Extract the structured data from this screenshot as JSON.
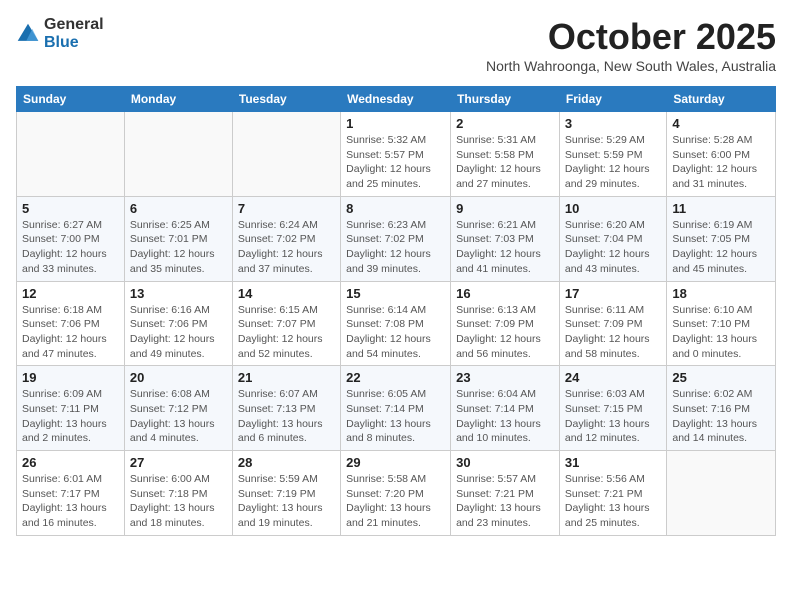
{
  "header": {
    "logo_general": "General",
    "logo_blue": "Blue",
    "month": "October 2025",
    "location": "North Wahroonga, New South Wales, Australia"
  },
  "weekdays": [
    "Sunday",
    "Monday",
    "Tuesday",
    "Wednesday",
    "Thursday",
    "Friday",
    "Saturday"
  ],
  "weeks": [
    [
      {
        "day": "",
        "info": ""
      },
      {
        "day": "",
        "info": ""
      },
      {
        "day": "",
        "info": ""
      },
      {
        "day": "1",
        "info": "Sunrise: 5:32 AM\nSunset: 5:57 PM\nDaylight: 12 hours\nand 25 minutes."
      },
      {
        "day": "2",
        "info": "Sunrise: 5:31 AM\nSunset: 5:58 PM\nDaylight: 12 hours\nand 27 minutes."
      },
      {
        "day": "3",
        "info": "Sunrise: 5:29 AM\nSunset: 5:59 PM\nDaylight: 12 hours\nand 29 minutes."
      },
      {
        "day": "4",
        "info": "Sunrise: 5:28 AM\nSunset: 6:00 PM\nDaylight: 12 hours\nand 31 minutes."
      }
    ],
    [
      {
        "day": "5",
        "info": "Sunrise: 6:27 AM\nSunset: 7:00 PM\nDaylight: 12 hours\nand 33 minutes."
      },
      {
        "day": "6",
        "info": "Sunrise: 6:25 AM\nSunset: 7:01 PM\nDaylight: 12 hours\nand 35 minutes."
      },
      {
        "day": "7",
        "info": "Sunrise: 6:24 AM\nSunset: 7:02 PM\nDaylight: 12 hours\nand 37 minutes."
      },
      {
        "day": "8",
        "info": "Sunrise: 6:23 AM\nSunset: 7:02 PM\nDaylight: 12 hours\nand 39 minutes."
      },
      {
        "day": "9",
        "info": "Sunrise: 6:21 AM\nSunset: 7:03 PM\nDaylight: 12 hours\nand 41 minutes."
      },
      {
        "day": "10",
        "info": "Sunrise: 6:20 AM\nSunset: 7:04 PM\nDaylight: 12 hours\nand 43 minutes."
      },
      {
        "day": "11",
        "info": "Sunrise: 6:19 AM\nSunset: 7:05 PM\nDaylight: 12 hours\nand 45 minutes."
      }
    ],
    [
      {
        "day": "12",
        "info": "Sunrise: 6:18 AM\nSunset: 7:06 PM\nDaylight: 12 hours\nand 47 minutes."
      },
      {
        "day": "13",
        "info": "Sunrise: 6:16 AM\nSunset: 7:06 PM\nDaylight: 12 hours\nand 49 minutes."
      },
      {
        "day": "14",
        "info": "Sunrise: 6:15 AM\nSunset: 7:07 PM\nDaylight: 12 hours\nand 52 minutes."
      },
      {
        "day": "15",
        "info": "Sunrise: 6:14 AM\nSunset: 7:08 PM\nDaylight: 12 hours\nand 54 minutes."
      },
      {
        "day": "16",
        "info": "Sunrise: 6:13 AM\nSunset: 7:09 PM\nDaylight: 12 hours\nand 56 minutes."
      },
      {
        "day": "17",
        "info": "Sunrise: 6:11 AM\nSunset: 7:09 PM\nDaylight: 12 hours\nand 58 minutes."
      },
      {
        "day": "18",
        "info": "Sunrise: 6:10 AM\nSunset: 7:10 PM\nDaylight: 13 hours\nand 0 minutes."
      }
    ],
    [
      {
        "day": "19",
        "info": "Sunrise: 6:09 AM\nSunset: 7:11 PM\nDaylight: 13 hours\nand 2 minutes."
      },
      {
        "day": "20",
        "info": "Sunrise: 6:08 AM\nSunset: 7:12 PM\nDaylight: 13 hours\nand 4 minutes."
      },
      {
        "day": "21",
        "info": "Sunrise: 6:07 AM\nSunset: 7:13 PM\nDaylight: 13 hours\nand 6 minutes."
      },
      {
        "day": "22",
        "info": "Sunrise: 6:05 AM\nSunset: 7:14 PM\nDaylight: 13 hours\nand 8 minutes."
      },
      {
        "day": "23",
        "info": "Sunrise: 6:04 AM\nSunset: 7:14 PM\nDaylight: 13 hours\nand 10 minutes."
      },
      {
        "day": "24",
        "info": "Sunrise: 6:03 AM\nSunset: 7:15 PM\nDaylight: 13 hours\nand 12 minutes."
      },
      {
        "day": "25",
        "info": "Sunrise: 6:02 AM\nSunset: 7:16 PM\nDaylight: 13 hours\nand 14 minutes."
      }
    ],
    [
      {
        "day": "26",
        "info": "Sunrise: 6:01 AM\nSunset: 7:17 PM\nDaylight: 13 hours\nand 16 minutes."
      },
      {
        "day": "27",
        "info": "Sunrise: 6:00 AM\nSunset: 7:18 PM\nDaylight: 13 hours\nand 18 minutes."
      },
      {
        "day": "28",
        "info": "Sunrise: 5:59 AM\nSunset: 7:19 PM\nDaylight: 13 hours\nand 19 minutes."
      },
      {
        "day": "29",
        "info": "Sunrise: 5:58 AM\nSunset: 7:20 PM\nDaylight: 13 hours\nand 21 minutes."
      },
      {
        "day": "30",
        "info": "Sunrise: 5:57 AM\nSunset: 7:21 PM\nDaylight: 13 hours\nand 23 minutes."
      },
      {
        "day": "31",
        "info": "Sunrise: 5:56 AM\nSunset: 7:21 PM\nDaylight: 13 hours\nand 25 minutes."
      },
      {
        "day": "",
        "info": ""
      }
    ]
  ]
}
